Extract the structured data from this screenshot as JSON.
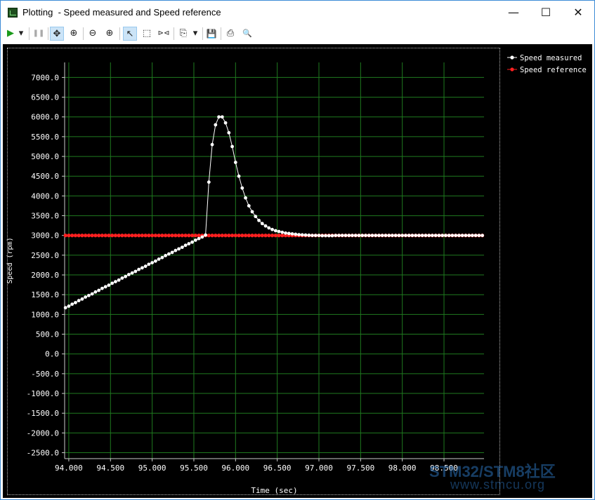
{
  "window": {
    "title": "Plotting  - Speed measured and Speed reference",
    "minimize_glyph": "—",
    "maximize_glyph": "☐",
    "close_glyph": "✕"
  },
  "toolbar": {
    "items": [
      {
        "name": "run-button",
        "glyph": "▶",
        "color": "#1a9a1a"
      },
      {
        "name": "run-dropdown-button",
        "glyph": "▾",
        "color": "#333333"
      },
      {
        "name": "pause-button",
        "glyph": "❚❚",
        "color": "#aaaaaa"
      },
      {
        "name": "pan-tool-button",
        "glyph": "✥",
        "active": true
      },
      {
        "name": "zoom-fit-button",
        "glyph": "⊕"
      },
      {
        "name": "zoom-out-button",
        "glyph": "⊖"
      },
      {
        "name": "zoom-in-button",
        "glyph": "⊕"
      },
      {
        "name": "select-tool-button",
        "glyph": "↖",
        "active": true
      },
      {
        "name": "rect-select-button",
        "glyph": "⬚"
      },
      {
        "name": "marker-button",
        "glyph": "⊳⊲"
      },
      {
        "name": "copy-button",
        "glyph": "⎘"
      },
      {
        "name": "copy-dropdown-button",
        "glyph": "▾"
      },
      {
        "name": "save-button",
        "glyph": "💾"
      },
      {
        "name": "print-button",
        "glyph": "⎙"
      },
      {
        "name": "print-preview-button",
        "glyph": "🔍"
      }
    ]
  },
  "chart_data": {
    "type": "line",
    "xlabel": "Time (sec)",
    "ylabel": "Speed (rpm)",
    "xlim": [
      93.95,
      98.98
    ],
    "ylim": [
      -2650,
      7380
    ],
    "xticks": [
      94.0,
      94.5,
      95.0,
      95.5,
      96.0,
      96.5,
      97.0,
      97.5,
      98.0,
      98.5
    ],
    "xtick_labels": [
      "94.000",
      "94.500",
      "95.000",
      "95.500",
      "96.000",
      "96.500",
      "97.000",
      "97.500",
      "98.000",
      "98.500"
    ],
    "yticks": [
      7000,
      6500,
      6000,
      5500,
      5000,
      4500,
      4000,
      3500,
      3000,
      2500,
      2000,
      1500,
      1000,
      500,
      0,
      -500,
      -1000,
      -1500,
      -2000,
      -2500
    ],
    "ytick_labels": [
      "7000.0",
      "6500.0",
      "6000.0",
      "5500.0",
      "5000.0",
      "4500.0",
      "4000.0",
      "3500.0",
      "3000.0",
      "2500.0",
      "2000.0",
      "1500.0",
      "1000.0",
      "500.0",
      "0.0",
      "-500.0",
      "-1000.0",
      "-1500.0",
      "-2000.0",
      "-2500.0"
    ],
    "grid": true,
    "background": "#000000",
    "grid_color": "#1f7a1f",
    "legend_position": "top-right",
    "series": [
      {
        "name": "Speed measured",
        "color": "#ffffff",
        "x": [
          93.96,
          94.0,
          94.04,
          94.08,
          94.12,
          94.16,
          94.2,
          94.24,
          94.28,
          94.32,
          94.36,
          94.4,
          94.44,
          94.48,
          94.52,
          94.56,
          94.6,
          94.64,
          94.68,
          94.72,
          94.76,
          94.8,
          94.84,
          94.88,
          94.92,
          94.96,
          95.0,
          95.04,
          95.08,
          95.12,
          95.16,
          95.2,
          95.24,
          95.28,
          95.32,
          95.36,
          95.4,
          95.44,
          95.48,
          95.52,
          95.56,
          95.6,
          95.64,
          95.68,
          95.72,
          95.76,
          95.8,
          95.84,
          95.88,
          95.92,
          95.96,
          96.0,
          96.04,
          96.08,
          96.12,
          96.16,
          96.2,
          96.24,
          96.28,
          96.32,
          96.36,
          96.4,
          96.44,
          96.48,
          96.52,
          96.56,
          96.6,
          96.64,
          96.68,
          96.72,
          96.76,
          96.8,
          96.84,
          96.88,
          96.92,
          96.96,
          97.0,
          97.04,
          97.08,
          97.12,
          97.16,
          97.2,
          97.24,
          97.28,
          97.32,
          97.36,
          97.4,
          97.44,
          97.48,
          97.52,
          97.56,
          97.6,
          97.64,
          97.68,
          97.72,
          97.76,
          97.8,
          97.84,
          97.88,
          97.92,
          97.96,
          98.0,
          98.04,
          98.08,
          98.12,
          98.16,
          98.2,
          98.24,
          98.28,
          98.32,
          98.36,
          98.4,
          98.44,
          98.48,
          98.52,
          98.56,
          98.6,
          98.64,
          98.68,
          98.72,
          98.76,
          98.8,
          98.84,
          98.88,
          98.92,
          98.96
        ],
        "y": [
          1170,
          1210,
          1260,
          1300,
          1350,
          1390,
          1440,
          1480,
          1520,
          1570,
          1610,
          1660,
          1700,
          1740,
          1790,
          1830,
          1870,
          1920,
          1960,
          2010,
          2050,
          2090,
          2140,
          2180,
          2220,
          2270,
          2310,
          2350,
          2400,
          2440,
          2490,
          2530,
          2570,
          2620,
          2660,
          2700,
          2750,
          2790,
          2830,
          2880,
          2920,
          2960,
          3010,
          4350,
          5300,
          5800,
          6000,
          6000,
          5850,
          5600,
          5250,
          4850,
          4500,
          4200,
          3950,
          3750,
          3600,
          3480,
          3380,
          3300,
          3240,
          3190,
          3150,
          3120,
          3100,
          3080,
          3060,
          3050,
          3040,
          3030,
          3020,
          3015,
          3010,
          3005,
          3000,
          3000,
          3000,
          2995,
          2995,
          2995,
          2995,
          3000,
          3000,
          3000,
          3000,
          3000,
          3000,
          3000,
          3000,
          3000,
          3000,
          3000,
          3000,
          3000,
          3000,
          3000,
          3000,
          3000,
          3000,
          3000,
          3000,
          3000,
          3000,
          3000,
          3000,
          3000,
          3000,
          3000,
          3000,
          3000,
          3000,
          3000,
          3000,
          3000,
          3000,
          3000,
          3000,
          3000,
          3000,
          3000,
          3000,
          3000,
          3000,
          3000,
          3000,
          3000
        ]
      },
      {
        "name": "Speed reference",
        "color": "#ff2020",
        "constant_y": 3000,
        "x_start": 93.96,
        "x_end": 98.96,
        "step": 0.04
      }
    ]
  },
  "watermark": {
    "line1": "STM32/STM8社区",
    "line2": "www.stmcu.org"
  }
}
